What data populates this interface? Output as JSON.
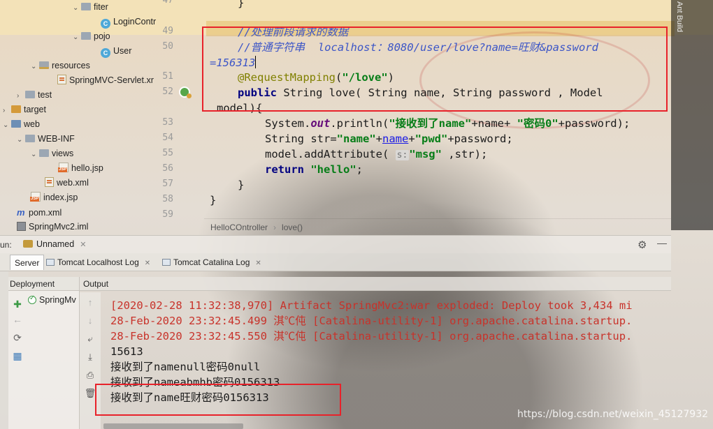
{
  "tree": {
    "items": [
      {
        "label": "fiter"
      },
      {
        "label": "LoginContr"
      },
      {
        "label": "pojo"
      },
      {
        "label": "User"
      },
      {
        "label": "resources"
      },
      {
        "label": "SpringMVC-Servlet.xr"
      },
      {
        "label": "test"
      },
      {
        "label": "target"
      },
      {
        "label": "web"
      },
      {
        "label": "WEB-INF"
      },
      {
        "label": "views"
      },
      {
        "label": "hello.jsp"
      },
      {
        "label": "web.xml"
      },
      {
        "label": "index.jsp"
      },
      {
        "label": "pom.xml"
      },
      {
        "label": "SpringMvc2.iml"
      }
    ]
  },
  "editor": {
    "line_numbers": [
      "47",
      "49",
      "50",
      "51",
      "52",
      "53",
      "54",
      "55",
      "56",
      "57",
      "58",
      "59"
    ],
    "lines": {
      "l47": "}",
      "l49": "//处理前段请求的数据",
      "l50a": "//普通字符串  localhost：8080/user/love?name=旺财&password",
      "l50b": "=156313",
      "l51_anno": "@RequestMapping",
      "l51_open": "(",
      "l51_str": "\"/love\"",
      "l51_close": ")",
      "l52_kw": "public",
      "l52_rest": " String love( String name, String password , Model",
      "l52b": "model){",
      "l53_a": "System.",
      "l53_field": "out",
      "l53_b": ".println(",
      "l53_s1": "\"接收到了name\"",
      "l53_c": "+name+ ",
      "l53_s2": "\"密码0\"",
      "l53_d": "+password);",
      "l54_a": "String str=",
      "l54_s1": "\"name\"",
      "l54_b": "+",
      "l54_link": "name",
      "l54_c": "+",
      "l54_s2": "\"pwd\"",
      "l54_d": "+password;",
      "l55_a": "model.addAttribute( ",
      "l55_hint": "s:",
      "l55_s": "\"msg\"",
      "l55_b": " ,str);",
      "l56_kw": "return",
      "l56_s": "\"hello\"",
      "l56_b": ";",
      "l57": "}",
      "l58": "}"
    },
    "breadcrumb": [
      "HelloCOntroller",
      "love()"
    ],
    "side_label": "Ant Build"
  },
  "run": {
    "label": "un:",
    "config_name": "Unnamed",
    "tabs": [
      {
        "label": "Server"
      },
      {
        "label": "Tomcat Localhost Log"
      },
      {
        "label": "Tomcat Catalina Log"
      }
    ],
    "deployment_header": "Deployment",
    "output_header": "Output",
    "deployment_item": "SpringMv",
    "console_lines": [
      {
        "text": "[2020-02-28 11:32:38,970] Artifact SpringMvc2:war exploded: Deploy took 3,434 mi",
        "color": "red"
      },
      {
        "text": "28-Feb-2020 23:32:45.499 淇℃伅 [Catalina-utility-1] org.apache.catalina.startup.",
        "color": "red"
      },
      {
        "text": "28-Feb-2020 23:32:45.550 淇℃伅 [Catalina-utility-1] org.apache.catalina.startup.",
        "color": "red"
      },
      {
        "text": "15613",
        "color": "black"
      },
      {
        "text": "接收到了namenull密码0null",
        "color": "black"
      },
      {
        "text": "接收到了nameabmhb密码0156313",
        "color": "black"
      },
      {
        "text": "接收到了name旺财密码0156313",
        "color": "black"
      }
    ]
  },
  "watermark": "https://blog.csdn.net/weixin_45127932",
  "colors": {
    "highlight_box": "#e8222a",
    "console_red": "#c8322a",
    "comment": "#3d56c7",
    "string": "#067d17"
  }
}
